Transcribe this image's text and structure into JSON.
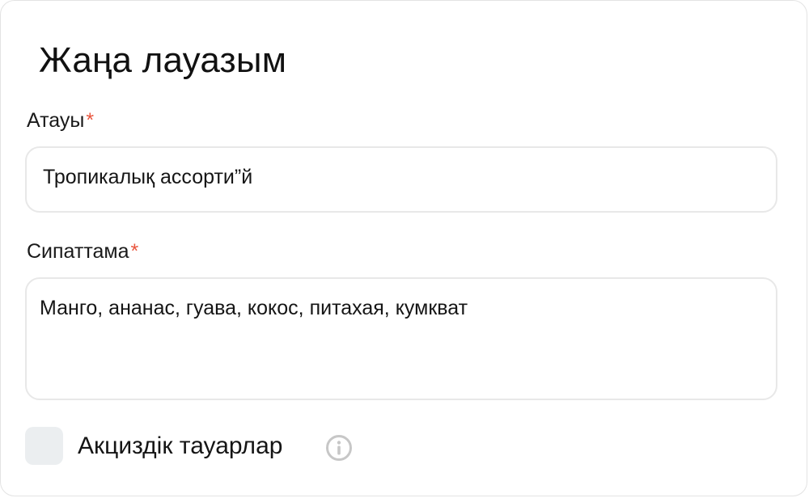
{
  "form": {
    "title": "Жаңа лауазым",
    "name": {
      "label": "Атауы",
      "required_mark": "*",
      "value": "Тропикалық ассорти”й"
    },
    "description": {
      "label": "Сипаттама",
      "required_mark": "*",
      "value": "Манго, ананас, гуава, кокос, питахая, кумкват"
    },
    "excise": {
      "label": "Акциздік тауарлар",
      "checked": false,
      "info_icon": "info-icon"
    }
  },
  "colors": {
    "required": "#e9553d",
    "checkbox_bg": "#ebeef0",
    "border": "#e8e8e8"
  }
}
